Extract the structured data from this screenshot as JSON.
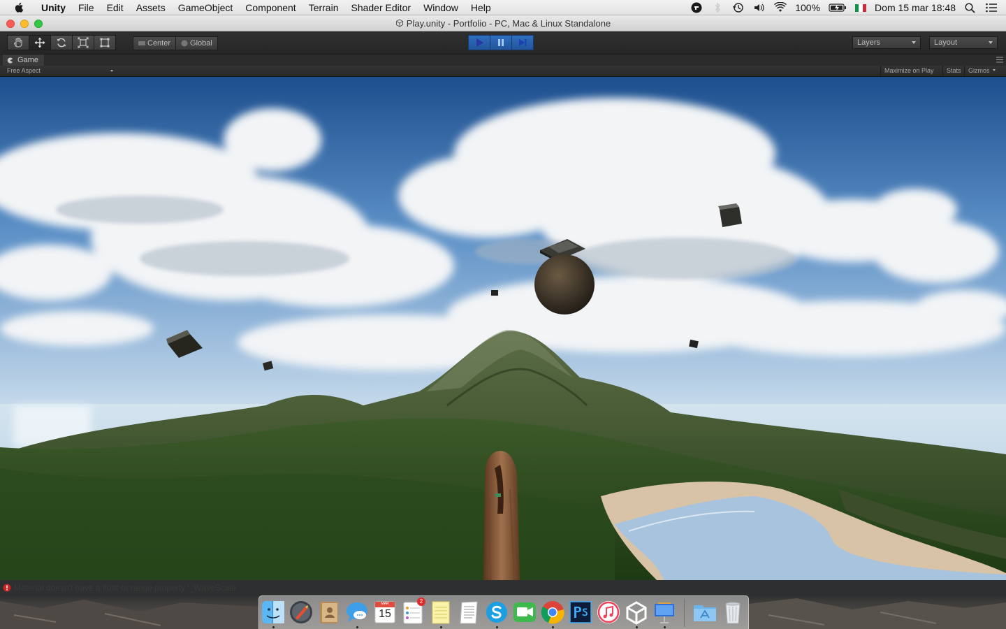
{
  "menubar": {
    "menus": [
      "Unity",
      "File",
      "Edit",
      "Assets",
      "GameObject",
      "Component",
      "Terrain",
      "Shader Editor",
      "Window",
      "Help"
    ],
    "battery": "100%",
    "clock": "Dom 15 mar  18:48",
    "status_icons": [
      "evernote-icon",
      "bluetooth-icon",
      "time-machine-icon",
      "volume-icon",
      "wifi-icon",
      "battery-icon",
      "italian-flag-icon",
      "spotlight-icon",
      "notification-center-icon"
    ]
  },
  "window": {
    "title": "Play.unity - Portfolio - PC, Mac & Linux Standalone"
  },
  "toolbar": {
    "transform_tools": [
      "hand-tool-icon",
      "move-tool-icon",
      "rotate-tool-icon",
      "scale-tool-icon",
      "rect-tool-icon"
    ],
    "active_tool": "move-tool-icon",
    "pivot_mode": "Center",
    "pivot_rotation": "Global",
    "play_controls": [
      "play-icon",
      "pause-icon",
      "step-icon"
    ],
    "layers_label": "Layers",
    "layout_label": "Layout",
    "accent_color": "#2f6ec0"
  },
  "game_view": {
    "tab_label": "Game",
    "aspect": "Free Aspect",
    "maximize_on_play": "Maximize on Play",
    "stats": "Stats",
    "gizmos": "Gizmos"
  },
  "console": {
    "message": "Material doesn't have a float or range property '_WaveScale'",
    "icon": "error-icon",
    "color": "#cc2222"
  },
  "dock": {
    "apps": [
      {
        "name": "finder-icon",
        "running": true
      },
      {
        "name": "launchpad-icon",
        "running": false
      },
      {
        "name": "contacts-icon",
        "running": false
      },
      {
        "name": "messages-icon",
        "running": true
      },
      {
        "name": "calendar-icon",
        "running": false,
        "month": "MAR",
        "day": "15"
      },
      {
        "name": "reminders-icon",
        "running": false,
        "badge": "2"
      },
      {
        "name": "notes-icon",
        "running": true
      },
      {
        "name": "textedit-icon",
        "running": false
      },
      {
        "name": "skype-icon",
        "running": true
      },
      {
        "name": "facetime-icon",
        "running": false
      },
      {
        "name": "chrome-icon",
        "running": true
      },
      {
        "name": "photoshop-icon",
        "running": false
      },
      {
        "name": "itunes-icon",
        "running": false
      },
      {
        "name": "unity-icon",
        "running": true
      },
      {
        "name": "keynote-icon",
        "running": true
      },
      {
        "name": "applications-folder-icon",
        "running": false
      },
      {
        "name": "trash-icon",
        "running": false
      }
    ]
  }
}
